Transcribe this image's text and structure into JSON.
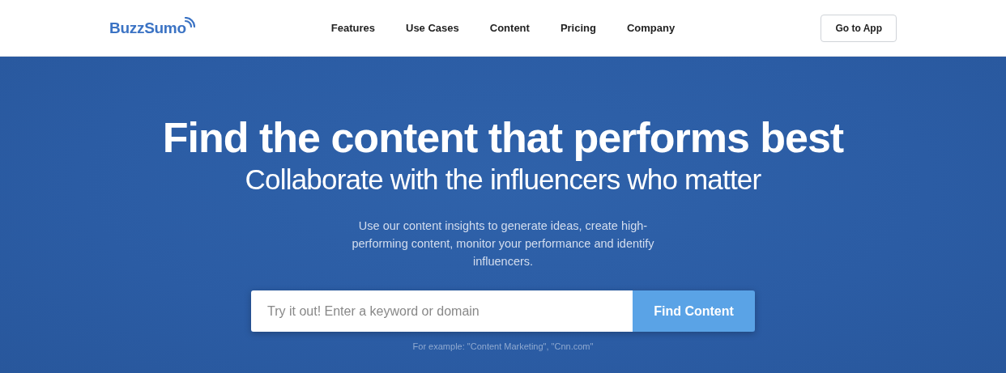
{
  "header": {
    "logo": "BuzzSumo",
    "nav": [
      "Features",
      "Use Cases",
      "Content",
      "Pricing",
      "Company"
    ],
    "cta": "Go to App"
  },
  "hero": {
    "title": "Find the content that performs best",
    "subtitle": "Collaborate with the influencers who matter",
    "description": "Use our content insights to generate ideas, create high-performing content, monitor your performance and identify influencers.",
    "search": {
      "placeholder": "Try it out! Enter a keyword or domain",
      "button": "Find Content"
    },
    "example": "For example: \"Content Marketing\", \"Cnn.com\""
  }
}
